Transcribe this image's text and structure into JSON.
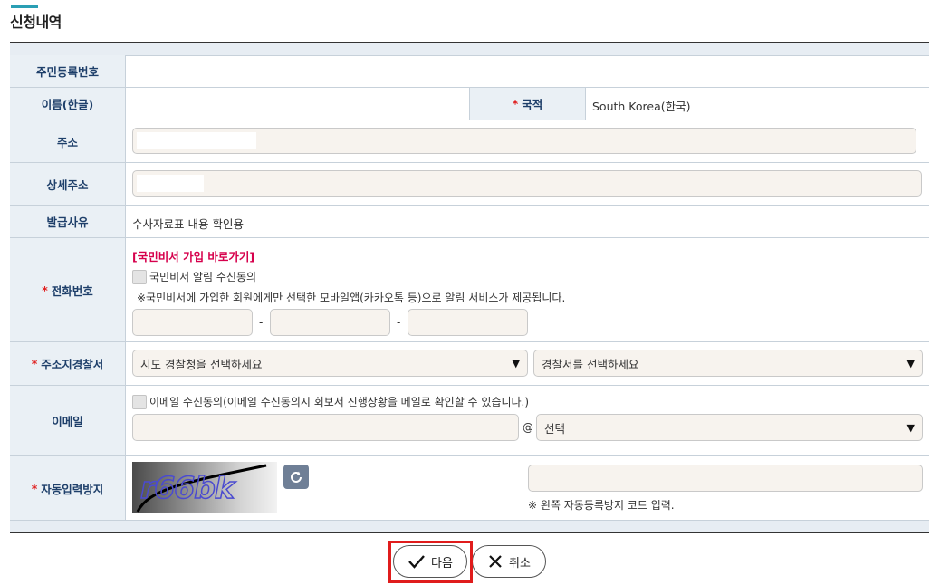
{
  "page": {
    "title": "신청내역"
  },
  "form": {
    "resident_id": {
      "label": "주민등록번호",
      "value": ""
    },
    "name": {
      "label": "이름(한글)",
      "value": ""
    },
    "nationality": {
      "label": "국적",
      "value": "South Korea(한국)"
    },
    "address": {
      "label": "주소",
      "value": ""
    },
    "detail_address": {
      "label": "상세주소",
      "value": ""
    },
    "reason": {
      "label": "발급사유",
      "value": "수사자료표 내용 확인용"
    },
    "phone": {
      "label": "전화번호",
      "link": "[국민비서 가입 바로가기]",
      "consent": "국민비서 알림 수신동의",
      "notice": "※국민비서에 가입한 회원에게만 선택한 모바일앱(카카오톡 등)으로 알림 서비스가 제공됩니다.",
      "separator": "-",
      "part1": "",
      "part2": "",
      "part3": ""
    },
    "police": {
      "label": "주소지경찰서",
      "agency_selected": "시도 경찰청을 선택하세요",
      "station_selected": "경찰서를 선택하세요"
    },
    "email": {
      "label": "이메일",
      "consent": "이메일 수신동의(이메일 수신동의시 회보서 진행상황을 메일로 확인할 수 있습니다.)",
      "at": "@",
      "id": "",
      "domain_selected": "선택"
    },
    "captcha": {
      "label": "자동입력방지",
      "image_text": "r66bk",
      "notice": "※ 왼쪽 자동등록방지 코드 입력.",
      "value": ""
    }
  },
  "buttons": {
    "next": "다음",
    "cancel": "취소"
  },
  "colors": {
    "accent": "#2a9fb4",
    "label_text": "#1e3f6a",
    "required": "#e02020",
    "link": "#d6004c",
    "highlight": "#e01c1c"
  }
}
